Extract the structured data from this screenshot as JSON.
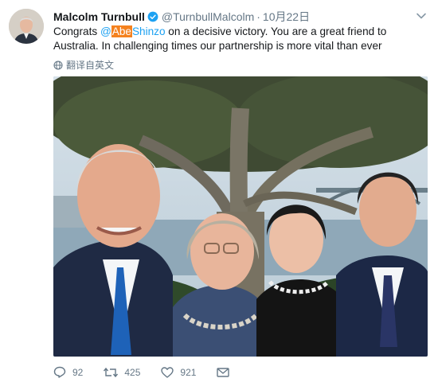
{
  "tweet": {
    "author_name": "Malcolm Turnbull",
    "handle": "@TurnbullMalcolm",
    "separator": "·",
    "date": "10月22日",
    "text_before": "Congrats ",
    "mention_at": "@",
    "mention_highlight": "Abe",
    "mention_rest": "Shinzo",
    "text_after": " on a decisive victory. You are a great friend to Australia. In challenging times our partnership is more vital than ever",
    "translate_label": "翻译自英文"
  },
  "actions": {
    "reply_count": "92",
    "retweet_count": "425",
    "like_count": "921"
  },
  "icons": {
    "verified": "verified-badge-icon",
    "caret": "chevron-down-icon",
    "translate": "globe-icon",
    "reply": "reply-icon",
    "retweet": "retweet-icon",
    "like": "heart-icon",
    "dm": "envelope-icon"
  },
  "colors": {
    "link": "#1da1f2",
    "highlight": "#f5821f",
    "muted": "#657786",
    "text": "#14171a"
  }
}
